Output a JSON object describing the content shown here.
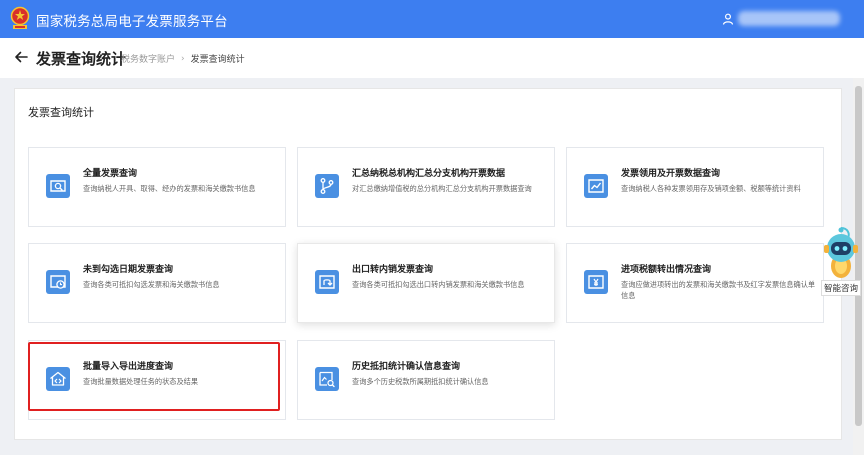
{
  "header": {
    "site_title": "国家税务总局电子发票服务平台",
    "brand_color": "#3d7ef0"
  },
  "subheader": {
    "page_title": "发票查询统计",
    "breadcrumb": [
      "税务数字账户",
      "发票查询统计"
    ]
  },
  "panel": {
    "title": "发票查询统计"
  },
  "cards": [
    {
      "title": "全量发票查询",
      "desc": "查询纳税人开具、取得、经办的发票和海关缴款书信息",
      "icon": "search-doc-icon"
    },
    {
      "title": "汇总纳税总机构汇总分支机构开票数据",
      "desc": "对汇总缴纳增值税的总分机构汇总分支机构开票数据查询",
      "icon": "branch-icon"
    },
    {
      "title": "发票领用及开票数据查询",
      "desc": "查询纳税人各种发票领用存及销项金额、税额等统计资料",
      "icon": "trend-chart-icon"
    },
    {
      "title": "未到勾选日期发票查询",
      "desc": "查询各类可抵扣勾选发票和海关缴款书信息",
      "icon": "clock-doc-icon"
    },
    {
      "title": "出口转内销发票查询",
      "desc": "查询各类可抵扣勾选出口转内销发票和海关缴款书信息",
      "icon": "return-doc-icon"
    },
    {
      "title": "进项税额转出情况查询",
      "desc": "查询应做进项转出的发票和海关缴款书及红字发票信息确认单信息",
      "icon": "yen-doc-icon"
    },
    {
      "title": "批量导入导出进度查询",
      "desc": "查询批量数据处理任务的状态及结果",
      "icon": "import-export-icon"
    },
    {
      "title": "历史抵扣统计确认信息查询",
      "desc": "查询多个历史税款所属期抵扣统计确认信息",
      "icon": "image-search-icon"
    }
  ],
  "assistant": {
    "label": "智能咨询"
  },
  "colors": {
    "icon_bg": "#4a90e2",
    "highlight": "#e02020"
  }
}
